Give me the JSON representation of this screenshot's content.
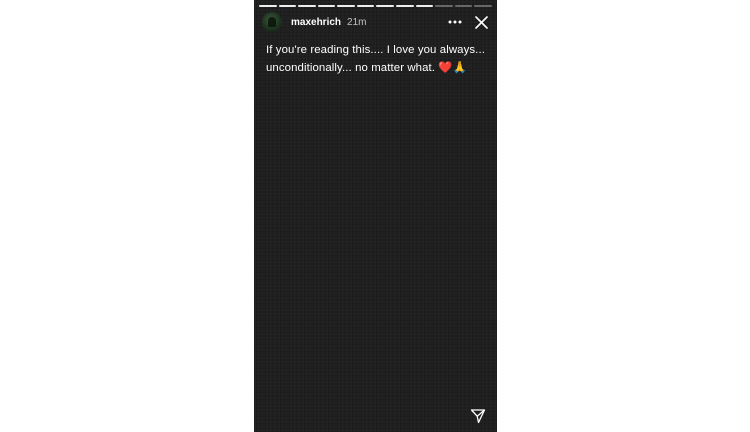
{
  "story": {
    "username": "maxehrich",
    "time": "21m",
    "caption": "If you're reading this.... I love you always... unconditionally... no matter what. ❤️🙏",
    "progress": {
      "total_segments": 12,
      "seen_segments": 9
    }
  },
  "icons": {
    "avatar": "avatar-photo",
    "more": "more-horizontal-icon",
    "close": "close-icon",
    "send": "send-paper-plane-icon"
  },
  "colors": {
    "story_background": "#1f1f1f",
    "page_background": "#ffffff",
    "text": "#ffffff"
  }
}
